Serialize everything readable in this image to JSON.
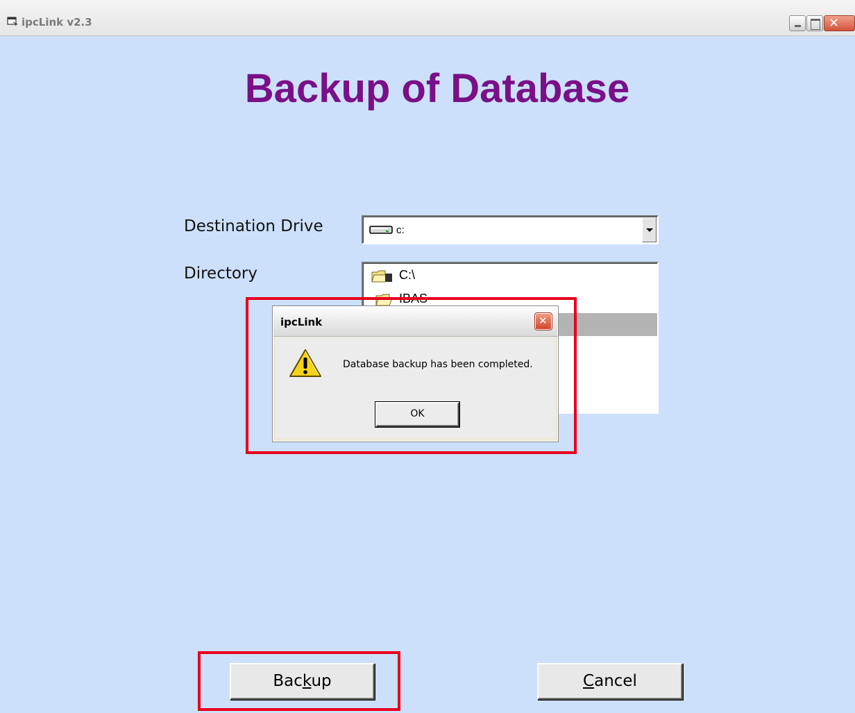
{
  "window": {
    "title": "ipcLink v2.3",
    "heading": "Backup of Database"
  },
  "form": {
    "destination_label": "Destination Drive",
    "destination_value": "c:",
    "directory_label": "Directory",
    "directories": [
      "C:\\",
      "IBAS"
    ]
  },
  "buttons": {
    "backup_prefix": "Bac",
    "backup_mnemonic": "k",
    "backup_suffix": "up",
    "cancel_mnemonic": "C",
    "cancel_suffix": "ancel"
  },
  "dialog": {
    "title": "ipcLink",
    "message": "Database backup has been completed.",
    "ok_label": "OK"
  },
  "colors": {
    "background": "#cce0fb",
    "heading": "#7a1087",
    "highlight_box": "#e8001c"
  },
  "icons": {
    "app": "app-icon",
    "drive": "hard-drive-icon",
    "folder": "open-folder-icon",
    "warning": "warning-icon"
  }
}
